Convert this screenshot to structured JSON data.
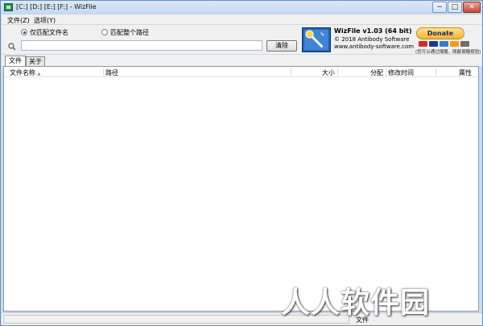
{
  "window": {
    "title": "[C:] [D:] [E:] [F:]  - WizFile",
    "controls": {
      "minimize": "−",
      "maximize": "□",
      "close": "✕"
    }
  },
  "menu": {
    "items": [
      "文件(Z)",
      "选项(Y)"
    ]
  },
  "search": {
    "match_options": [
      {
        "label": "仅匹配文件名",
        "selected": true
      },
      {
        "label": "匹配整个路径",
        "selected": false
      }
    ],
    "input_value": "",
    "clear_label": "清除"
  },
  "about": {
    "product": "WizFile v1.03 (64 bit)",
    "copyright": "© 2018 Antibody Software",
    "website": "www.antibody-software.com"
  },
  "donate": {
    "label": "Donate",
    "note": "(您可以通过捐赠，随献捐赠按钮)",
    "card_colors": [
      "#d22b2b",
      "#1a3d8f",
      "#2d7fd1",
      "#f29a1f",
      "#6e6e6e"
    ]
  },
  "tabs": [
    {
      "label": "文件",
      "active": true
    },
    {
      "label": "关于",
      "active": false
    }
  ],
  "list": {
    "columns": [
      "文件名称",
      "路径",
      "大小",
      "分配",
      "修改时间",
      "属性"
    ],
    "sort_indicator": "▲",
    "rows": []
  },
  "status": {
    "text": "文件"
  },
  "watermark": {
    "text": "人人软件园"
  },
  "colors": {
    "accent": "#1a4d9a",
    "donate": "#f5b335"
  }
}
